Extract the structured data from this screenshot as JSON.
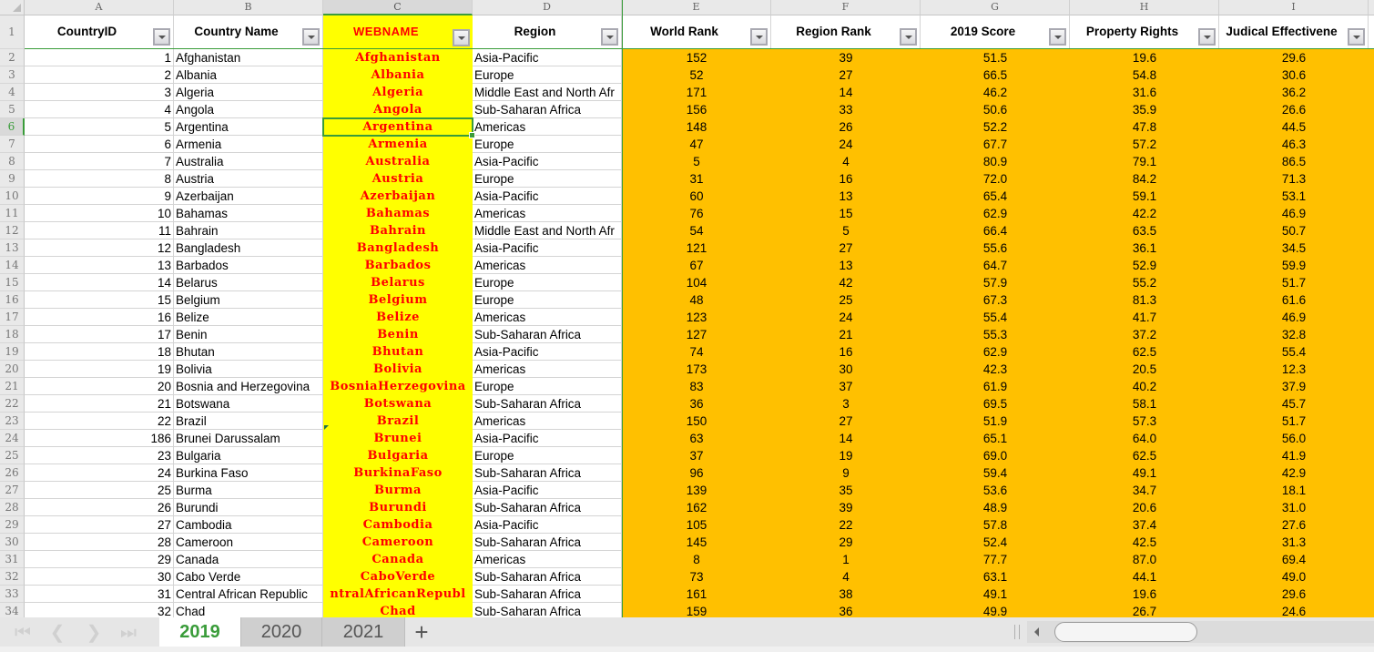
{
  "app": {
    "type": "spreadsheet"
  },
  "column_letters": [
    "A",
    "B",
    "C",
    "D",
    "E",
    "F",
    "G",
    "H",
    "I"
  ],
  "selected_column": "C",
  "selected_row": 6,
  "headers": [
    "CountryID",
    "Country Name",
    "WEBNAME",
    "Region",
    "World Rank",
    "Region Rank",
    "2019 Score",
    "Property Rights",
    "Judical Effectivene"
  ],
  "colors": {
    "webname_fill": "#ffff00",
    "webname_text": "#ff0000",
    "numeric_fill": "#ffc000",
    "selection_green": "#3a9c3a"
  },
  "rows": [
    {
      "row": 2,
      "id": "1",
      "name": "Afghanistan",
      "web": "Afghanistan",
      "region": "Asia-Pacific",
      "world_rank": "152",
      "region_rank": "39",
      "score": "51.5",
      "property_rights": "19.6",
      "judicial": "29.6"
    },
    {
      "row": 3,
      "id": "2",
      "name": "Albania",
      "web": "Albania",
      "region": "Europe",
      "world_rank": "52",
      "region_rank": "27",
      "score": "66.5",
      "property_rights": "54.8",
      "judicial": "30.6"
    },
    {
      "row": 4,
      "id": "3",
      "name": "Algeria",
      "web": "Algeria",
      "region": "Middle East and North Afr",
      "world_rank": "171",
      "region_rank": "14",
      "score": "46.2",
      "property_rights": "31.6",
      "judicial": "36.2"
    },
    {
      "row": 5,
      "id": "4",
      "name": "Angola",
      "web": "Angola",
      "region": "Sub-Saharan Africa",
      "world_rank": "156",
      "region_rank": "33",
      "score": "50.6",
      "property_rights": "35.9",
      "judicial": "26.6"
    },
    {
      "row": 6,
      "id": "5",
      "name": "Argentina",
      "web": "Argentina",
      "region": "Americas",
      "world_rank": "148",
      "region_rank": "26",
      "score": "52.2",
      "property_rights": "47.8",
      "judicial": "44.5"
    },
    {
      "row": 7,
      "id": "6",
      "name": "Armenia",
      "web": "Armenia",
      "region": "Europe",
      "world_rank": "47",
      "region_rank": "24",
      "score": "67.7",
      "property_rights": "57.2",
      "judicial": "46.3"
    },
    {
      "row": 8,
      "id": "7",
      "name": "Australia",
      "web": "Australia",
      "region": "Asia-Pacific",
      "world_rank": "5",
      "region_rank": "4",
      "score": "80.9",
      "property_rights": "79.1",
      "judicial": "86.5"
    },
    {
      "row": 9,
      "id": "8",
      "name": "Austria",
      "web": "Austria",
      "region": "Europe",
      "world_rank": "31",
      "region_rank": "16",
      "score": "72.0",
      "property_rights": "84.2",
      "judicial": "71.3"
    },
    {
      "row": 10,
      "id": "9",
      "name": "Azerbaijan",
      "web": "Azerbaijan",
      "region": "Asia-Pacific",
      "world_rank": "60",
      "region_rank": "13",
      "score": "65.4",
      "property_rights": "59.1",
      "judicial": "53.1"
    },
    {
      "row": 11,
      "id": "10",
      "name": "Bahamas",
      "web": "Bahamas",
      "region": "Americas",
      "world_rank": "76",
      "region_rank": "15",
      "score": "62.9",
      "property_rights": "42.2",
      "judicial": "46.9"
    },
    {
      "row": 12,
      "id": "11",
      "name": "Bahrain",
      "web": "Bahrain",
      "region": "Middle East and North Afr",
      "world_rank": "54",
      "region_rank": "5",
      "score": "66.4",
      "property_rights": "63.5",
      "judicial": "50.7"
    },
    {
      "row": 13,
      "id": "12",
      "name": "Bangladesh",
      "web": "Bangladesh",
      "region": "Asia-Pacific",
      "world_rank": "121",
      "region_rank": "27",
      "score": "55.6",
      "property_rights": "36.1",
      "judicial": "34.5"
    },
    {
      "row": 14,
      "id": "13",
      "name": "Barbados",
      "web": "Barbados",
      "region": "Americas",
      "world_rank": "67",
      "region_rank": "13",
      "score": "64.7",
      "property_rights": "52.9",
      "judicial": "59.9"
    },
    {
      "row": 15,
      "id": "14",
      "name": "Belarus",
      "web": "Belarus",
      "region": "Europe",
      "world_rank": "104",
      "region_rank": "42",
      "score": "57.9",
      "property_rights": "55.2",
      "judicial": "51.7"
    },
    {
      "row": 16,
      "id": "15",
      "name": "Belgium",
      "web": "Belgium",
      "region": "Europe",
      "world_rank": "48",
      "region_rank": "25",
      "score": "67.3",
      "property_rights": "81.3",
      "judicial": "61.6"
    },
    {
      "row": 17,
      "id": "16",
      "name": "Belize",
      "web": "Belize",
      "region": "Americas",
      "world_rank": "123",
      "region_rank": "24",
      "score": "55.4",
      "property_rights": "41.7",
      "judicial": "46.9"
    },
    {
      "row": 18,
      "id": "17",
      "name": "Benin",
      "web": "Benin",
      "region": "Sub-Saharan Africa",
      "world_rank": "127",
      "region_rank": "21",
      "score": "55.3",
      "property_rights": "37.2",
      "judicial": "32.8"
    },
    {
      "row": 19,
      "id": "18",
      "name": "Bhutan",
      "web": "Bhutan",
      "region": "Asia-Pacific",
      "world_rank": "74",
      "region_rank": "16",
      "score": "62.9",
      "property_rights": "62.5",
      "judicial": "55.4"
    },
    {
      "row": 20,
      "id": "19",
      "name": "Bolivia",
      "web": "Bolivia",
      "region": "Americas",
      "world_rank": "173",
      "region_rank": "30",
      "score": "42.3",
      "property_rights": "20.5",
      "judicial": "12.3"
    },
    {
      "row": 21,
      "id": "20",
      "name": "Bosnia and Herzegovina",
      "web": "BosniaHerzegovina",
      "region": "Europe",
      "world_rank": "83",
      "region_rank": "37",
      "score": "61.9",
      "property_rights": "40.2",
      "judicial": "37.9"
    },
    {
      "row": 22,
      "id": "21",
      "name": "Botswana",
      "web": "Botswana",
      "region": "Sub-Saharan Africa",
      "world_rank": "36",
      "region_rank": "3",
      "score": "69.5",
      "property_rights": "58.1",
      "judicial": "45.7"
    },
    {
      "row": 23,
      "id": "22",
      "name": "Brazil",
      "web": "Brazil",
      "region": "Americas",
      "world_rank": "150",
      "region_rank": "27",
      "score": "51.9",
      "property_rights": "57.3",
      "judicial": "51.7"
    },
    {
      "row": 24,
      "id": "186",
      "name": "Brunei Darussalam",
      "web": "Brunei",
      "region": "Asia-Pacific",
      "world_rank": "63",
      "region_rank": "14",
      "score": "65.1",
      "property_rights": "64.0",
      "judicial": "56.0"
    },
    {
      "row": 25,
      "id": "23",
      "name": "Bulgaria",
      "web": "Bulgaria",
      "region": "Europe",
      "world_rank": "37",
      "region_rank": "19",
      "score": "69.0",
      "property_rights": "62.5",
      "judicial": "41.9"
    },
    {
      "row": 26,
      "id": "24",
      "name": "Burkina Faso",
      "web": "BurkinaFaso",
      "region": "Sub-Saharan Africa",
      "world_rank": "96",
      "region_rank": "9",
      "score": "59.4",
      "property_rights": "49.1",
      "judicial": "42.9"
    },
    {
      "row": 27,
      "id": "25",
      "name": "Burma",
      "web": "Burma",
      "region": "Asia-Pacific",
      "world_rank": "139",
      "region_rank": "35",
      "score": "53.6",
      "property_rights": "34.7",
      "judicial": "18.1"
    },
    {
      "row": 28,
      "id": "26",
      "name": "Burundi",
      "web": "Burundi",
      "region": "Sub-Saharan Africa",
      "world_rank": "162",
      "region_rank": "39",
      "score": "48.9",
      "property_rights": "20.6",
      "judicial": "31.0"
    },
    {
      "row": 29,
      "id": "27",
      "name": "Cambodia",
      "web": "Cambodia",
      "region": "Asia-Pacific",
      "world_rank": "105",
      "region_rank": "22",
      "score": "57.8",
      "property_rights": "37.4",
      "judicial": "27.6"
    },
    {
      "row": 30,
      "id": "28",
      "name": "Cameroon",
      "web": "Cameroon",
      "region": "Sub-Saharan Africa",
      "world_rank": "145",
      "region_rank": "29",
      "score": "52.4",
      "property_rights": "42.5",
      "judicial": "31.3"
    },
    {
      "row": 31,
      "id": "29",
      "name": "Canada",
      "web": "Canada",
      "region": "Americas",
      "world_rank": "8",
      "region_rank": "1",
      "score": "77.7",
      "property_rights": "87.0",
      "judicial": "69.4"
    },
    {
      "row": 32,
      "id": "30",
      "name": "Cabo Verde",
      "web": "CaboVerde",
      "region": "Sub-Saharan Africa",
      "world_rank": "73",
      "region_rank": "4",
      "score": "63.1",
      "property_rights": "44.1",
      "judicial": "49.0"
    },
    {
      "row": 33,
      "id": "31",
      "name": "Central African Republic",
      "web": "ntralAfricanRepubl",
      "region": "Sub-Saharan Africa",
      "world_rank": "161",
      "region_rank": "38",
      "score": "49.1",
      "property_rights": "19.6",
      "judicial": "29.6"
    },
    {
      "row": 34,
      "id": "32",
      "name": "Chad",
      "web": "Chad",
      "region": "Sub-Saharan Africa",
      "world_rank": "159",
      "region_rank": "36",
      "score": "49.9",
      "property_rights": "26.7",
      "judicial": "24.6"
    }
  ],
  "sheet_tabs": [
    {
      "label": "2019",
      "active": true
    },
    {
      "label": "2020",
      "active": false
    },
    {
      "label": "2021",
      "active": false
    }
  ],
  "tab_nav": {
    "first": "|<",
    "prev": "<",
    "next": ">",
    "last": ">|"
  },
  "add_sheet_label": "+"
}
